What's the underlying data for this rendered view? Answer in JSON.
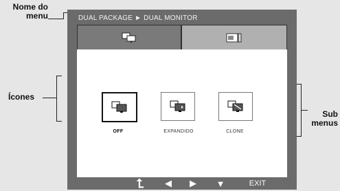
{
  "callouts": {
    "menu_name_line1": "Nome do",
    "menu_name_line2": "menu",
    "icons": "Ícones",
    "submenus_line1": "Sub",
    "submenus_line2": "menus"
  },
  "osd": {
    "breadcrumb": "DUAL PACKAGE ► DUAL MONITOR",
    "tabs": [
      {
        "icon": "dual-monitor-icon",
        "active": true
      },
      {
        "icon": "package-icon",
        "active": false
      }
    ],
    "options": [
      {
        "label": "OFF",
        "icon": "monitor-off-icon",
        "selected": true
      },
      {
        "label": "EXPANDIDO",
        "icon": "monitor-expand-icon",
        "selected": false
      },
      {
        "label": "CLONE",
        "icon": "monitor-clone-icon",
        "selected": false
      }
    ],
    "nav": {
      "back": "⮤",
      "left": "◀",
      "right": "▶",
      "down": "▼",
      "exit": "EXIT"
    }
  }
}
